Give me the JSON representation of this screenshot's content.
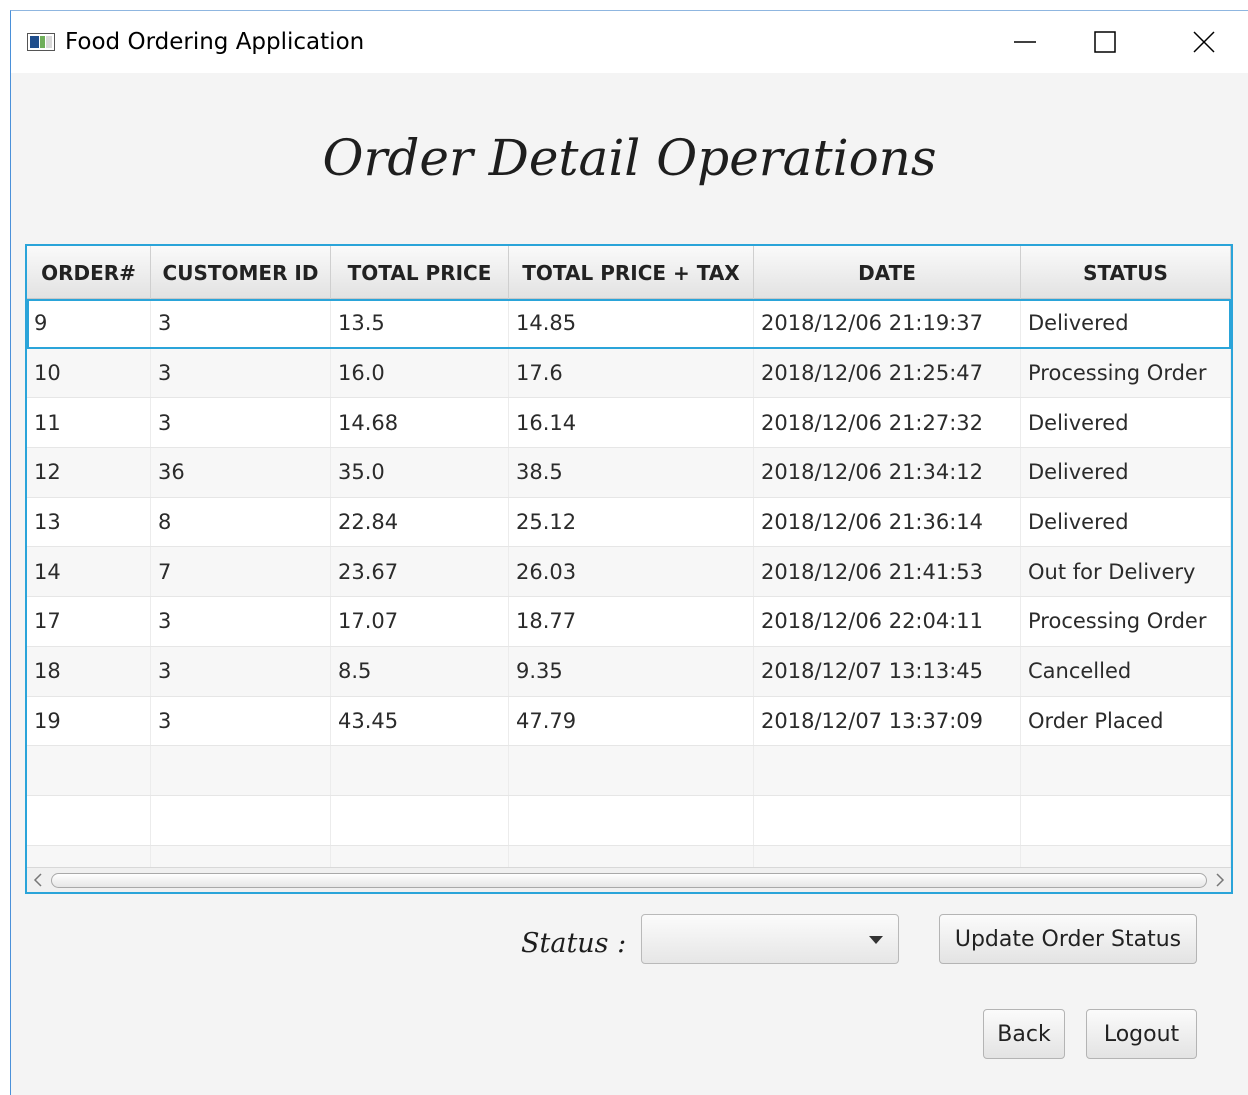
{
  "window": {
    "title": "Food Ordering Application"
  },
  "page": {
    "title": "Order Detail Operations"
  },
  "table": {
    "columns": [
      "ORDER#",
      "CUSTOMER ID",
      "TOTAL PRICE",
      "TOTAL PRICE + TAX",
      "DATE",
      "STATUS"
    ],
    "rows": [
      [
        "9",
        "3",
        "13.5",
        "14.85",
        "2018/12/06 21:19:37",
        "Delivered"
      ],
      [
        "10",
        "3",
        "16.0",
        "17.6",
        "2018/12/06 21:25:47",
        "Processing Order"
      ],
      [
        "11",
        "3",
        "14.68",
        "16.14",
        "2018/12/06 21:27:32",
        "Delivered"
      ],
      [
        "12",
        "36",
        "35.0",
        "38.5",
        "2018/12/06 21:34:12",
        "Delivered"
      ],
      [
        "13",
        "8",
        "22.84",
        "25.12",
        "2018/12/06 21:36:14",
        "Delivered"
      ],
      [
        "14",
        "7",
        "23.67",
        "26.03",
        "2018/12/06 21:41:53",
        "Out for Delivery"
      ],
      [
        "17",
        "3",
        "17.07",
        "18.77",
        "2018/12/06 22:04:11",
        "Processing Order"
      ],
      [
        "18",
        "3",
        "8.5",
        "9.35",
        "2018/12/07 13:13:45",
        "Cancelled"
      ],
      [
        "19",
        "3",
        "43.45",
        "47.79",
        "2018/12/07 13:37:09",
        "Order Placed"
      ]
    ],
    "selected_row": 0
  },
  "controls": {
    "status_label": "Status :",
    "status_value": "",
    "update_label": "Update Order Status",
    "back_label": "Back",
    "logout_label": "Logout"
  },
  "icons": {
    "app": "app-window-icon",
    "minimize": "minimize-icon",
    "maximize": "maximize-icon",
    "close": "close-icon",
    "dropdown": "chevron-down-icon"
  },
  "colors": {
    "focus": "#2aa4d9"
  }
}
